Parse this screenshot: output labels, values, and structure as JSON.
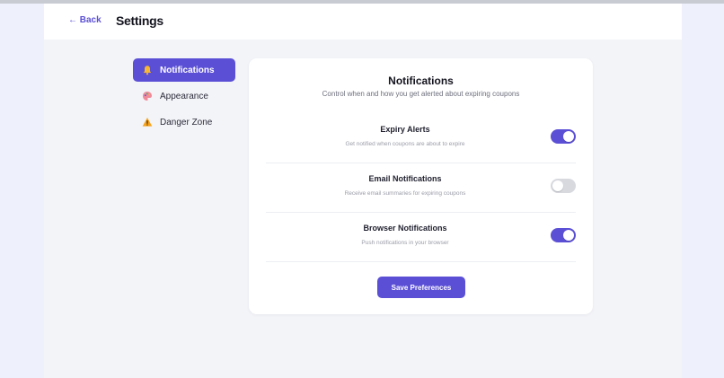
{
  "header": {
    "back_label": "← Back",
    "title": "Settings"
  },
  "sidebar": {
    "items": [
      {
        "label": "Notifications",
        "icon": "bell-icon",
        "active": true
      },
      {
        "label": "Appearance",
        "icon": "palette-icon",
        "active": false
      },
      {
        "label": "Danger Zone",
        "icon": "warning-icon",
        "active": false
      }
    ]
  },
  "card": {
    "title": "Notifications",
    "subtitle": "Control when and how you get alerted about expiring coupons",
    "settings": [
      {
        "title": "Expiry Alerts",
        "description": "Get notified when coupons are about to expire",
        "enabled": true
      },
      {
        "title": "Email Notifications",
        "description": "Receive email summaries for expiring coupons",
        "enabled": false
      },
      {
        "title": "Browser Notifications",
        "description": "Push notifications in your browser",
        "enabled": true
      }
    ],
    "save_label": "Save Preferences"
  },
  "colors": {
    "accent": "#5b4fd6",
    "page_background": "#eef1fb",
    "toggle_off": "#d7d9df"
  }
}
